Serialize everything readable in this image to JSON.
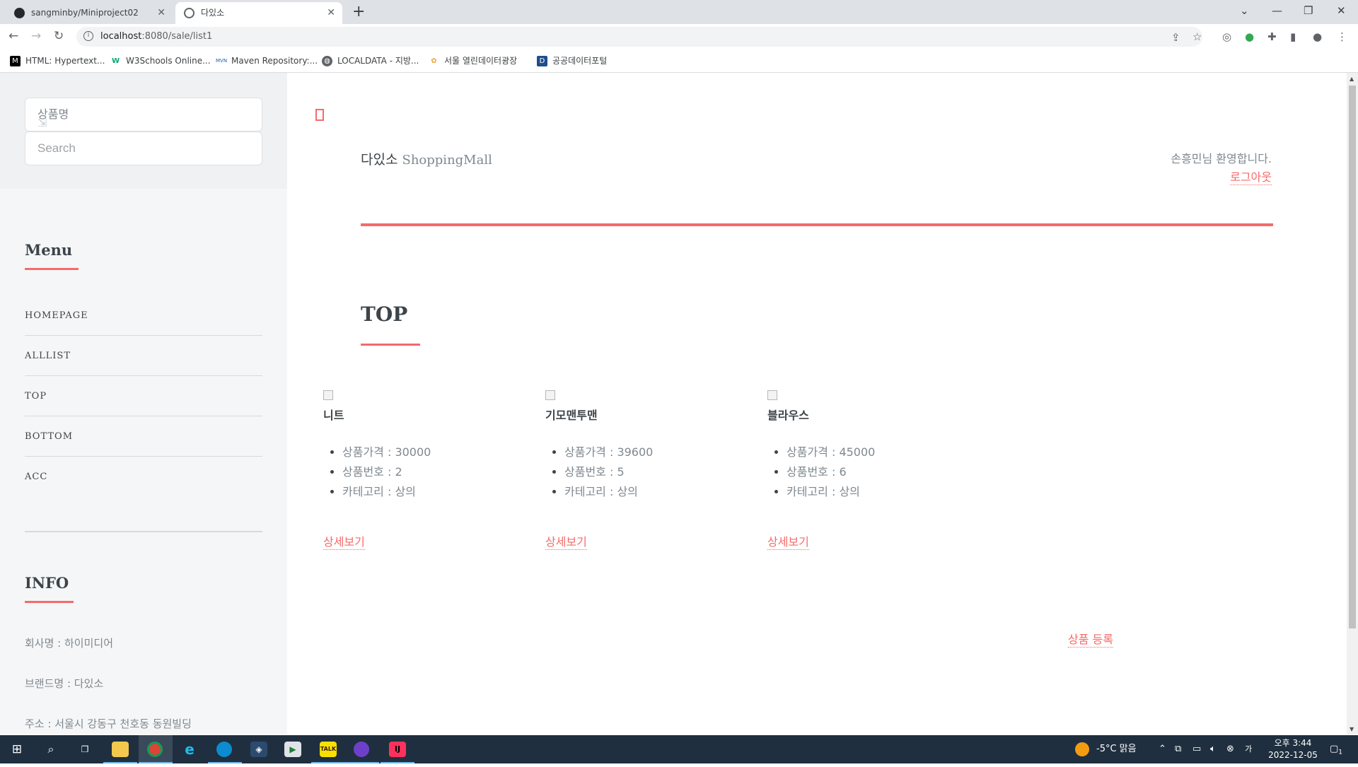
{
  "browser": {
    "tabs": [
      {
        "title": "sangminby/Miniproject02",
        "active": false
      },
      {
        "title": "다있소",
        "active": true
      }
    ],
    "url_host": "localhost",
    "url_rest": ":8080/sale/list1",
    "bookmarks": [
      {
        "label": "HTML: Hypertext...",
        "icon": "mdn-icon"
      },
      {
        "label": "W3Schools Online...",
        "icon": "w3schools-icon"
      },
      {
        "label": "Maven Repository:...",
        "icon": "maven-icon"
      },
      {
        "label": "LOCALDATA - 지방...",
        "icon": "globe-icon"
      },
      {
        "label": "서울 열린데이터광장",
        "icon": "seoul-data-icon"
      },
      {
        "label": "공공데이터포털",
        "icon": "data-portal-icon"
      }
    ]
  },
  "sidebar": {
    "search": {
      "select_value": "상품명",
      "placeholder": "Search"
    },
    "menu_title": "Menu",
    "menu_items": [
      "HOMEPAGE",
      "ALLLIST",
      "TOP",
      "BOTTOM",
      "ACC"
    ],
    "info_title": "INFO",
    "info_lines": [
      "회사명 : 하이미디어",
      "브랜드명 : 다있소",
      "주소 : 서울시 강동구 천호동 동원빌딩"
    ]
  },
  "header": {
    "brand_ko": "다있소",
    "brand_en": "ShoppingMall",
    "welcome": "손흥민님 환영합니다.",
    "logout": "로그아웃"
  },
  "section": {
    "title": "TOP"
  },
  "products": [
    {
      "name": "니트",
      "price": "상품가격 : 30000",
      "number": "상품번호 : 2",
      "category": "카테고리 : 상의",
      "detail": "상세보기"
    },
    {
      "name": "기모맨투맨",
      "price": "상품가격 : 39600",
      "number": "상품번호 : 5",
      "category": "카테고리 : 상의",
      "detail": "상세보기"
    },
    {
      "name": "블라우스",
      "price": "상품가격 : 45000",
      "number": "상품번호 : 6",
      "category": "카테고리 : 상의",
      "detail": "상세보기"
    }
  ],
  "register_label": "상품 등록",
  "taskbar": {
    "weather": "-5°C  맑음",
    "time": "오후 3:44",
    "date": "2022-12-05",
    "notification_count": "1"
  },
  "colors": {
    "accent": "#f56a6a",
    "text": "#3d4449",
    "muted": "#7f888f",
    "sidebar_bg": "#f5f6f7",
    "taskbar_bg": "#1f2f3f"
  }
}
